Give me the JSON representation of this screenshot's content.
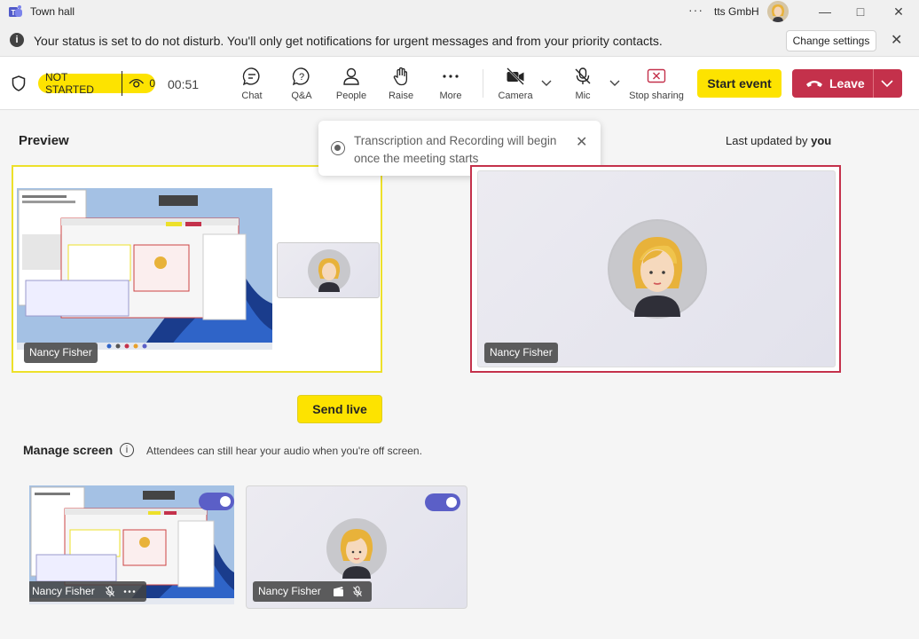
{
  "titlebar": {
    "app_title": "Town hall",
    "more_label": "···",
    "org_name": "tts GmbH",
    "minimize": "—",
    "maximize": "□",
    "close": "✕"
  },
  "notification": {
    "text": "Your status is set to do not disturb. You'll only get notifications for urgent messages and from your priority contacts.",
    "change_settings": "Change settings",
    "close": "✕"
  },
  "toolbar": {
    "status": "NOT STARTED",
    "viewer_count": "0",
    "timer": "00:51",
    "buttons": {
      "chat": "Chat",
      "qa": "Q&A",
      "people": "People",
      "raise": "Raise",
      "more": "More",
      "camera": "Camera",
      "mic": "Mic",
      "stop_sharing": "Stop sharing"
    },
    "start_event": "Start event",
    "leave": "Leave"
  },
  "main": {
    "preview_title": "Preview",
    "last_updated_prefix": "Last updated by ",
    "last_updated_by": "you",
    "toast": {
      "message": "Transcription and Recording will begin once the meeting starts",
      "close": "✕"
    },
    "stage": {
      "presenter": "Nancy Fisher"
    },
    "live": {
      "presenter": "Nancy Fisher"
    },
    "send_live": "Send live",
    "manage": {
      "title": "Manage screen",
      "info": "i",
      "hint": "Attendees can still hear your audio when you're off screen.",
      "sources": [
        {
          "name": "Nancy Fisher",
          "type": "screen",
          "enabled": true
        },
        {
          "name": "Nancy Fisher",
          "type": "camera",
          "enabled": true
        }
      ]
    }
  },
  "colors": {
    "accent_yellow": "#fde300",
    "leave_red": "#c4314b",
    "toggle_purple": "#5b5fc7"
  }
}
